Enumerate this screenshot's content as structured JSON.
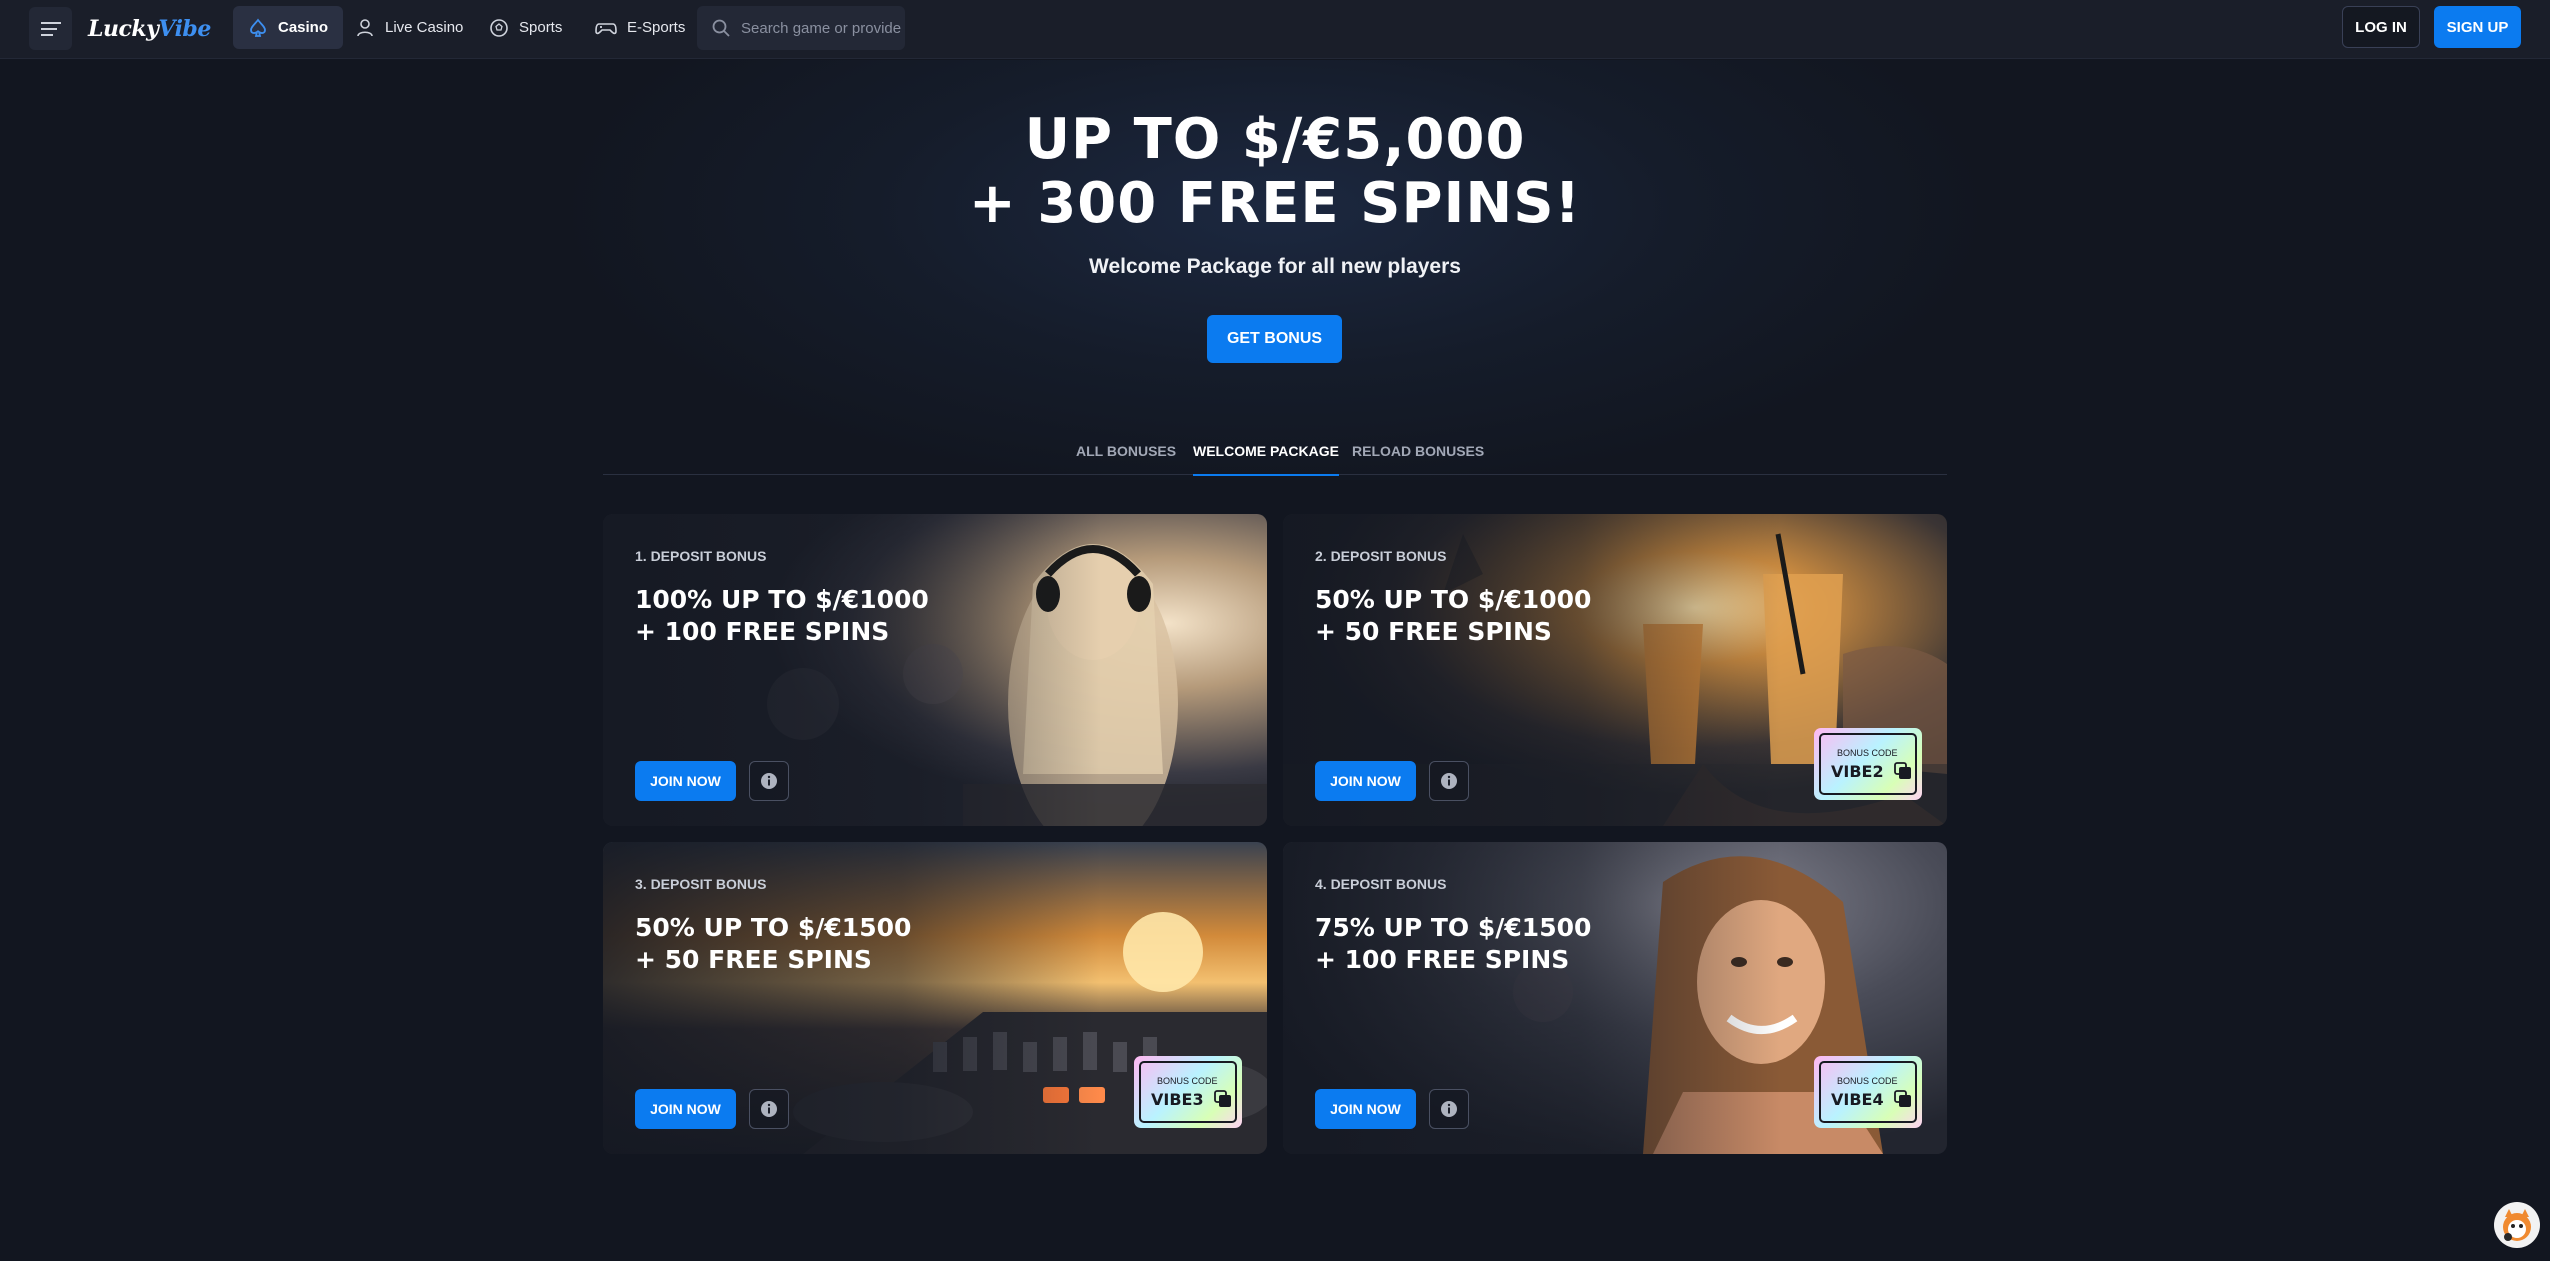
{
  "header": {
    "logo_text_1": "Lucky",
    "logo_text_2": "Vibe",
    "nav": [
      {
        "label": "Casino",
        "icon": "spade-icon",
        "active": true
      },
      {
        "label": "Live Casino",
        "icon": "dealer-icon",
        "active": false
      },
      {
        "label": "Sports",
        "icon": "soccer-ball-icon",
        "active": false
      },
      {
        "label": "E-Sports",
        "icon": "gamepad-icon",
        "active": false
      }
    ],
    "search_placeholder": "Search game or provider",
    "login_label": "LOG IN",
    "signup_label": "SIGN UP"
  },
  "hero": {
    "title_line1": "UP TO $/€5,000",
    "title_line2": "+ 300 FREE SPINS!",
    "subtitle": "Welcome Package for all new players",
    "cta_label": "GET BONUS"
  },
  "tabs": [
    {
      "label": "ALL BONUSES",
      "active": false
    },
    {
      "label": "WELCOME PACKAGE",
      "active": true
    },
    {
      "label": "RELOAD BONUSES",
      "active": false
    }
  ],
  "cards": [
    {
      "label": "1. DEPOSIT BONUS",
      "title_line1": "100% UP TO $/€1000",
      "title_line2": "+ 100 FREE SPINS",
      "join_label": "JOIN NOW",
      "bonus_code_label": "",
      "bonus_code": ""
    },
    {
      "label": "2. DEPOSIT BONUS",
      "title_line1": "50% UP TO $/€1000",
      "title_line2": "+ 50 FREE SPINS",
      "join_label": "JOIN NOW",
      "bonus_code_label": "BONUS CODE",
      "bonus_code": "VIBE2"
    },
    {
      "label": "3. DEPOSIT BONUS",
      "title_line1": "50% UP TO $/€1500",
      "title_line2": "+ 50 FREE SPINS",
      "join_label": "JOIN NOW",
      "bonus_code_label": "BONUS CODE",
      "bonus_code": "VIBE3"
    },
    {
      "label": "4. DEPOSIT BONUS",
      "title_line1": "75% UP TO $/€1500",
      "title_line2": "+ 100 FREE SPINS",
      "join_label": "JOIN NOW",
      "bonus_code_label": "BONUS CODE",
      "bonus_code": "VIBE4"
    }
  ],
  "colors": {
    "accent": "#0b7bf0",
    "background": "#121620",
    "header": "#1a1e29"
  }
}
